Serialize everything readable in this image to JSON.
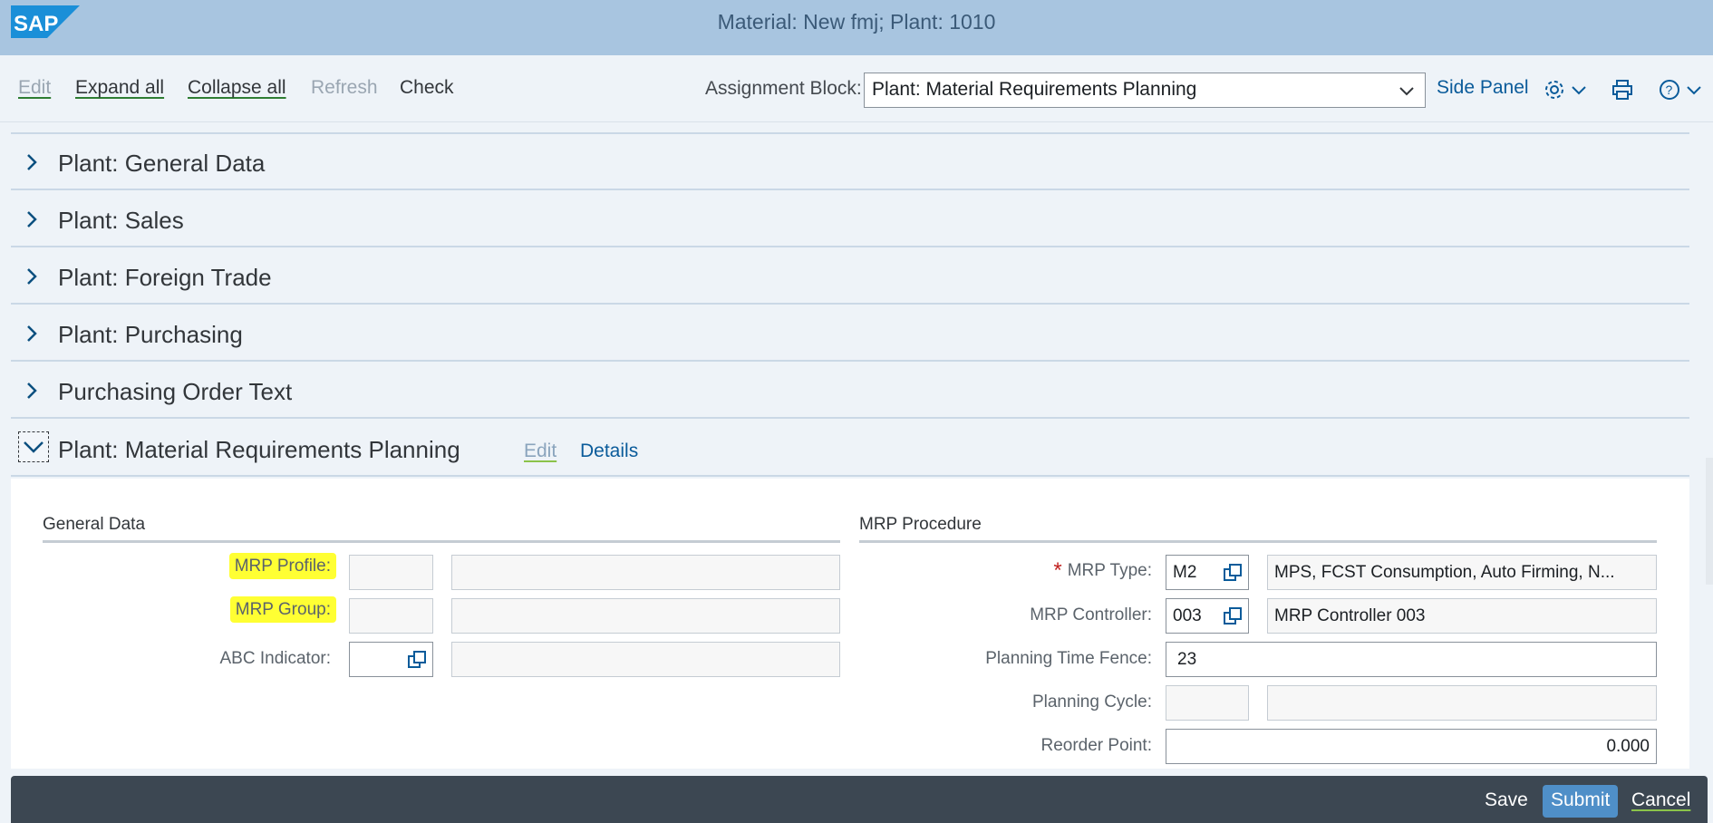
{
  "shell": {
    "title": "Material: New fmj; Plant: 1010",
    "logo_text": "SAP"
  },
  "toolbar": {
    "edit": "Edit",
    "expand_all": "Expand all",
    "collapse_all": "Collapse all",
    "refresh": "Refresh",
    "check": "Check",
    "assignment_label": "Assignment Block:",
    "assignment_value": "Plant: Material Requirements Planning",
    "side_panel": "Side Panel"
  },
  "blocks": [
    {
      "label": "Plant: General Data"
    },
    {
      "label": "Plant: Sales"
    },
    {
      "label": "Plant: Foreign Trade"
    },
    {
      "label": "Plant: Purchasing"
    },
    {
      "label": "Purchasing Order Text"
    }
  ],
  "expanded": {
    "label": "Plant: Material Requirements Planning",
    "edit": "Edit",
    "details": "Details"
  },
  "general": {
    "title": "General Data",
    "mrp_profile_label": "MRP Profile:",
    "mrp_group_label": "MRP Group:",
    "abc_label": "ABC Indicator:"
  },
  "procedure": {
    "title": "MRP Procedure",
    "mrp_type_label": "MRP Type:",
    "mrp_type_code": "M2",
    "mrp_type_desc": "MPS, FCST Consumption, Auto Firming, N...",
    "controller_label": "MRP Controller:",
    "controller_code": "003",
    "controller_desc": "MRP Controller 003",
    "fence_label": "Planning Time Fence:",
    "fence_value": "23",
    "cycle_label": "Planning Cycle:",
    "reorder_label": "Reorder Point:",
    "reorder_value": "0.000"
  },
  "footer": {
    "save": "Save",
    "submit": "Submit",
    "cancel": "Cancel"
  },
  "colors": {
    "shell": "#a8c5e0",
    "highlight": "#ffff33",
    "footer": "#3c4752",
    "primary": "#4f8fc8"
  }
}
